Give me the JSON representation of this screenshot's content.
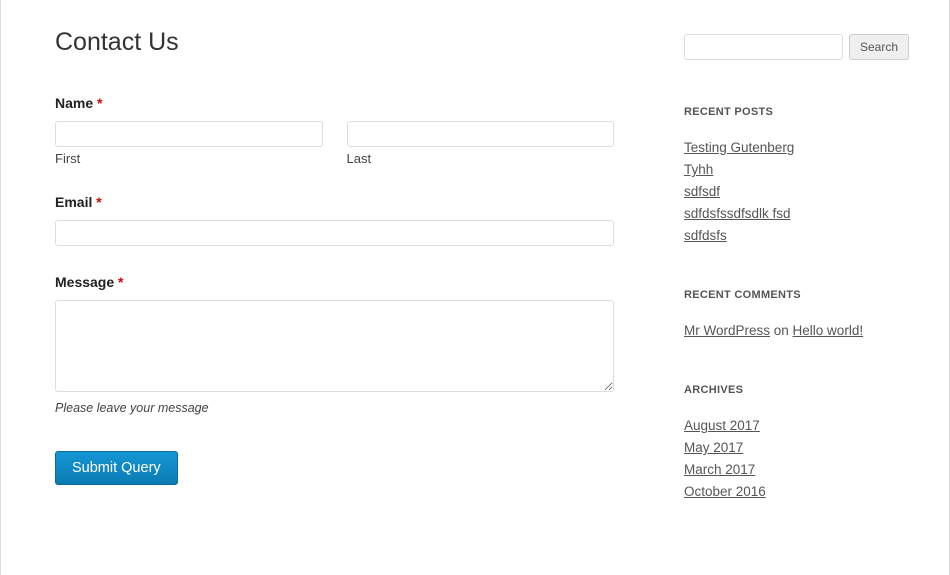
{
  "page": {
    "title": "Contact Us"
  },
  "form": {
    "name": {
      "label": "Name",
      "required_mark": "*",
      "first_sublabel": "First",
      "last_sublabel": "Last"
    },
    "email": {
      "label": "Email",
      "required_mark": "*"
    },
    "message": {
      "label": "Message",
      "required_mark": "*",
      "hint": "Please leave your message"
    },
    "submit_label": "Submit Query"
  },
  "sidebar": {
    "search_button": "Search",
    "recent_posts": {
      "title": "RECENT POSTS",
      "items": [
        "Testing Gutenberg",
        "Tyhh",
        "sdfsdf",
        "sdfdsfssdfsdlk fsd",
        "sdfdsfs"
      ]
    },
    "recent_comments": {
      "title": "RECENT COMMENTS",
      "author": "Mr WordPress",
      "joiner": " on ",
      "post": "Hello world!"
    },
    "archives": {
      "title": "ARCHIVES",
      "items": [
        "August 2017",
        "May 2017",
        "March 2017",
        "October 2016"
      ]
    }
  }
}
